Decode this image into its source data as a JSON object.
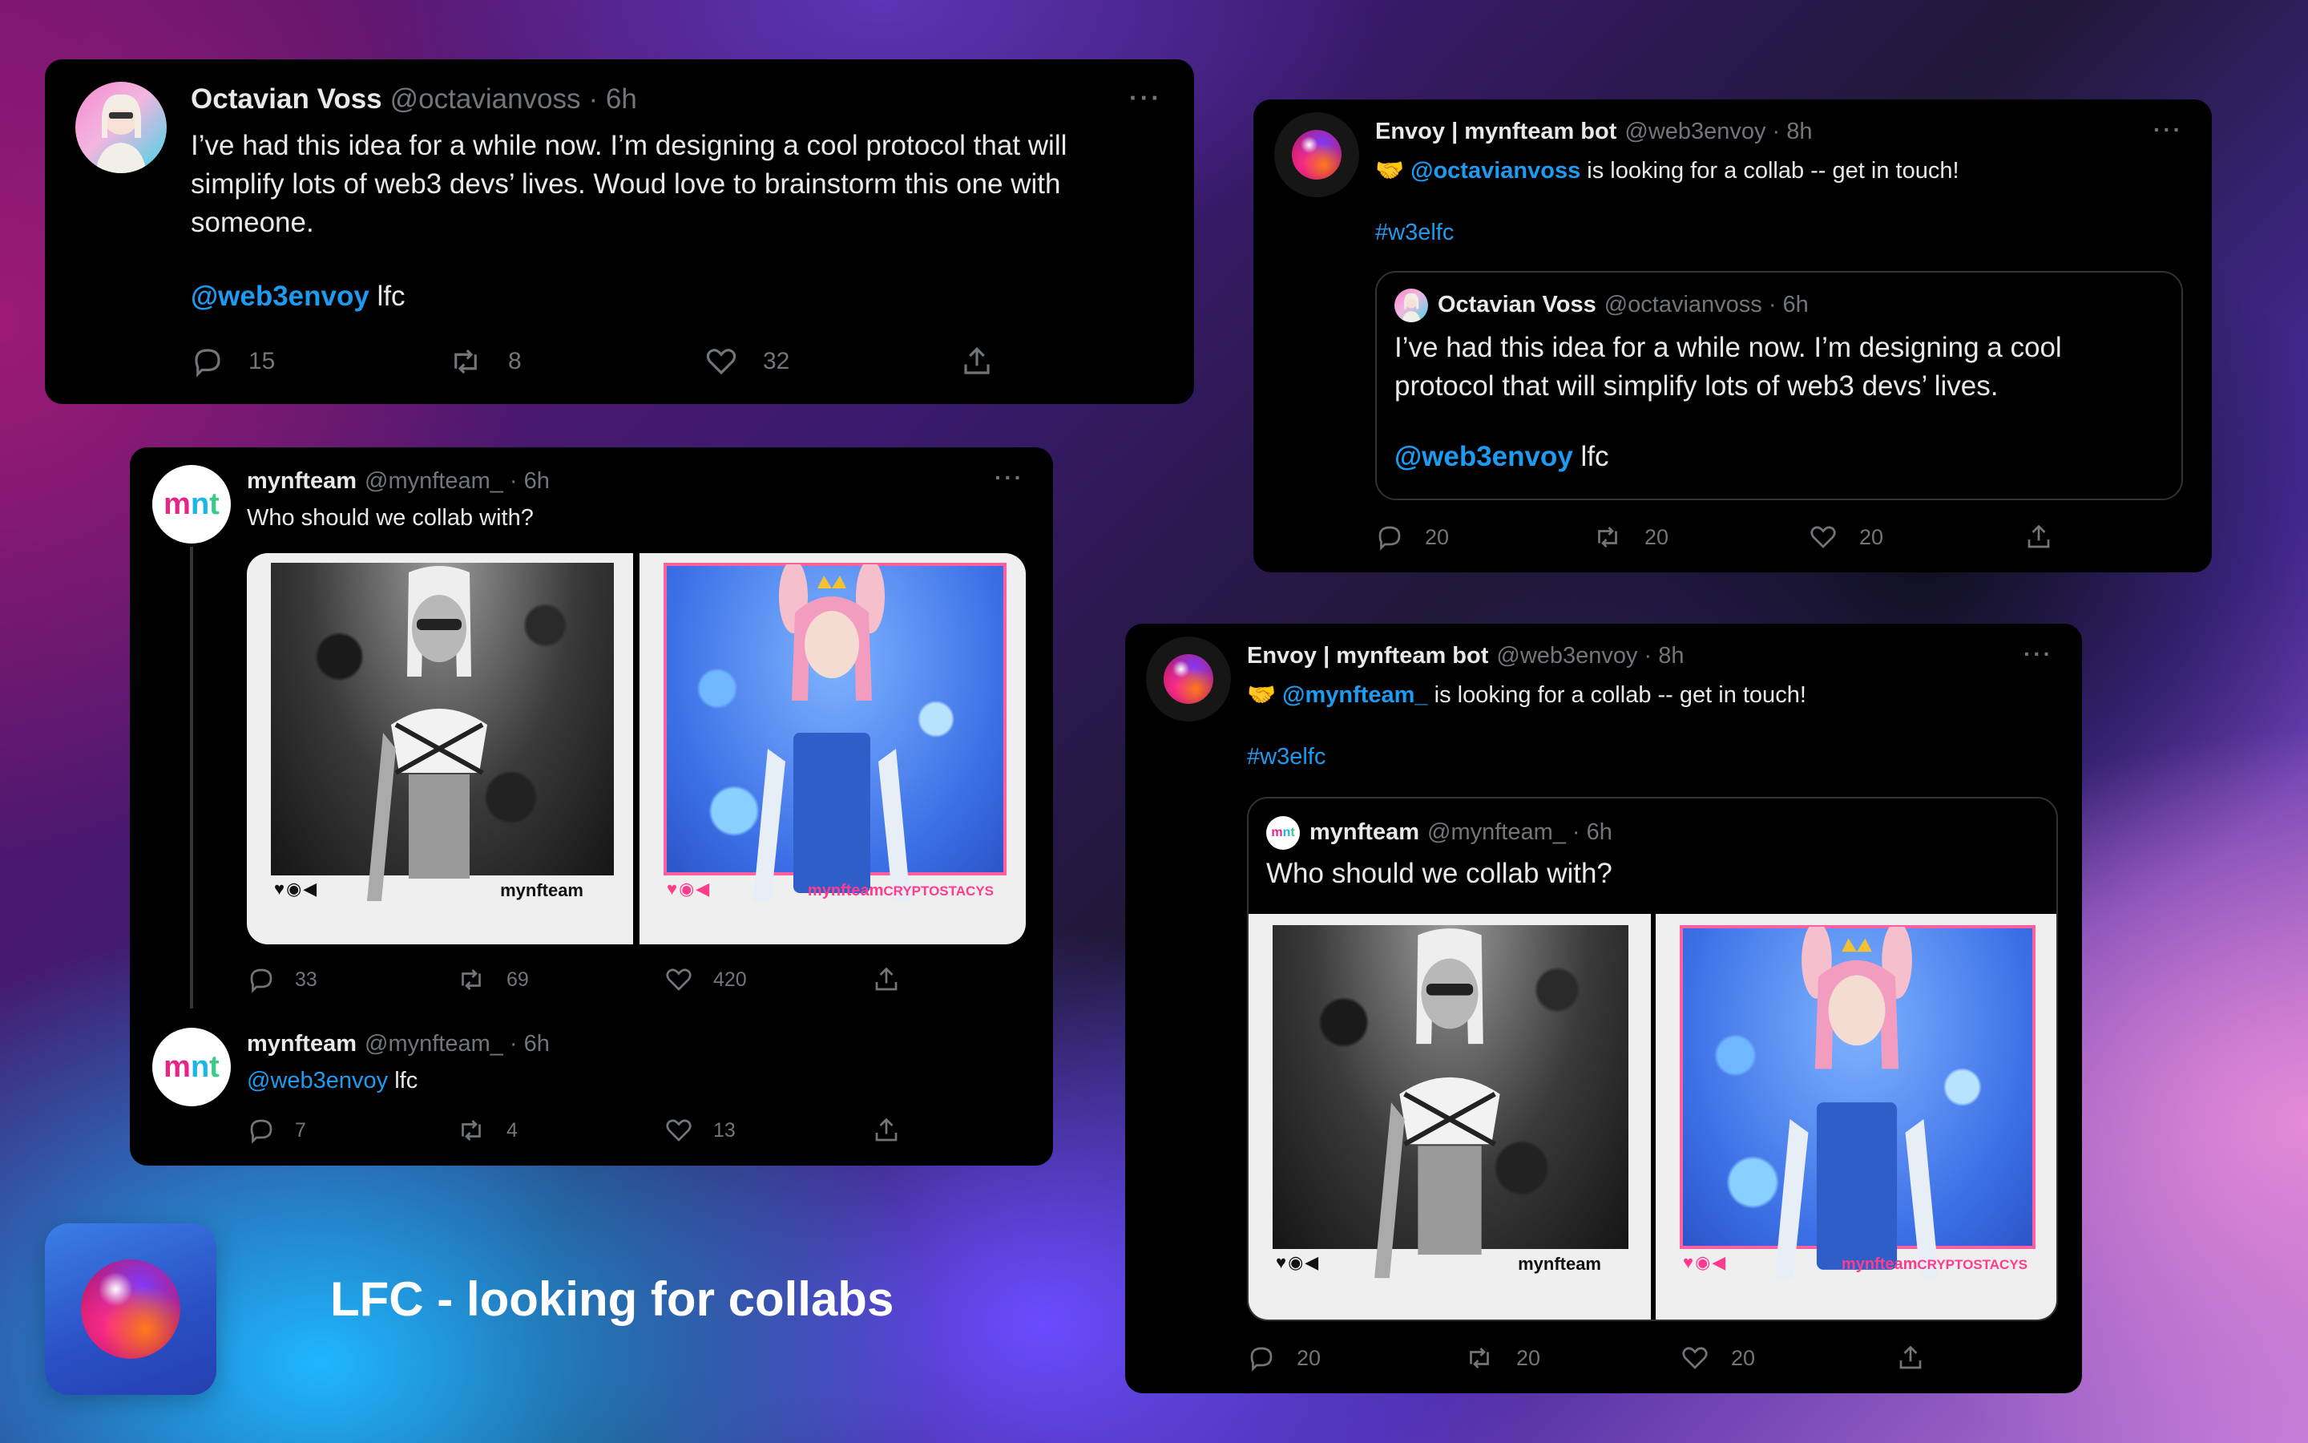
{
  "colors": {
    "card_bg": "#000000",
    "link": "#1d9bf0",
    "muted": "#71767b",
    "mnt_m": "#e62686",
    "mnt_n": "#19b6e6",
    "mnt_t": "#3cc98a",
    "nft_pink": "#ff5fa0"
  },
  "tweet1": {
    "name": "Octavian Voss",
    "handle": "@octavianvoss",
    "time": "· 6h",
    "more": "···",
    "text": "I’ve had this idea for a while now. I’m designing a cool protocol that will simplify lots of web3 devs’ lives. Woud love to brainstorm this one with someone.",
    "mention": "@web3envoy",
    "mention_suffix": " lfc",
    "replies": "15",
    "retweets": "8",
    "likes": "32"
  },
  "tweet2": {
    "name": "Envoy | mynfteam bot",
    "handle": "@web3envoy",
    "time": "· 8h",
    "more": "···",
    "emoji": "🤝",
    "mention": "@octavianvoss",
    "text_suffix": " is looking for a collab -- get in touch!",
    "hashtag": "#w3elfc",
    "quote": {
      "name": "Octavian Voss",
      "handle": "@octavianvoss",
      "time": "· 6h",
      "text": "I’ve had this idea for a while now. I’m designing a cool protocol that will simplify lots of web3 devs’ lives.",
      "mention": "@web3envoy",
      "mention_suffix": " lfc"
    },
    "replies": "20",
    "retweets": "20",
    "likes": "20"
  },
  "tweet3": {
    "avatar_letters": [
      "m",
      "n",
      "t"
    ],
    "name": "mynfteam",
    "handle": "@mynfteam_",
    "time": "· 6h",
    "more": "···",
    "text": "Who should we collab with?",
    "image1_caption": "mynfteam",
    "image2_caption": "mynfteam",
    "image2_collab": "CRYPTOSTACYS",
    "image_icons": "♥◉◀",
    "replies": "33",
    "retweets": "69",
    "likes": "420",
    "reply": {
      "name": "mynfteam",
      "handle": "@mynfteam_",
      "time": "· 6h",
      "mention": "@web3envoy",
      "mention_suffix": " lfc",
      "replies": "7",
      "retweets": "4",
      "likes": "13"
    }
  },
  "tweet4": {
    "name": "Envoy | mynfteam bot",
    "handle": "@web3envoy",
    "time": "· 8h",
    "more": "···",
    "emoji": "🤝",
    "mention": "@mynfteam_",
    "text_suffix": " is looking for a collab -- get in touch!",
    "hashtag": "#w3elfc",
    "quote": {
      "name": "mynfteam",
      "handle": "@mynfteam_",
      "time": "· 6h",
      "text": "Who should we collab with?",
      "image1_caption": "mynfteam",
      "image2_caption": "mynfteam",
      "image2_collab": "CRYPTOSTACYS",
      "image_icons": "♥◉◀"
    },
    "replies": "20",
    "retweets": "20",
    "likes": "20"
  },
  "footer": {
    "tagline": "LFC - looking for collabs"
  }
}
